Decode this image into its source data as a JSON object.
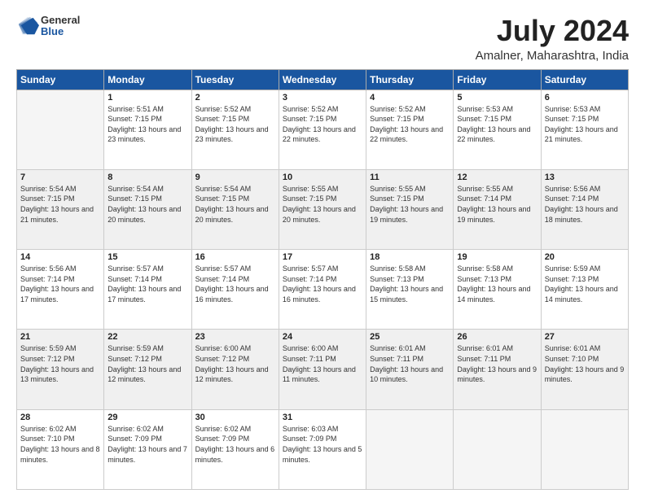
{
  "logo": {
    "general": "General",
    "blue": "Blue"
  },
  "title": "July 2024",
  "location": "Amalner, Maharashtra, India",
  "days_of_week": [
    "Sunday",
    "Monday",
    "Tuesday",
    "Wednesday",
    "Thursday",
    "Friday",
    "Saturday"
  ],
  "weeks": [
    [
      {
        "day": "",
        "sunrise": "",
        "sunset": "",
        "daylight": ""
      },
      {
        "day": "1",
        "sunrise": "Sunrise: 5:51 AM",
        "sunset": "Sunset: 7:15 PM",
        "daylight": "Daylight: 13 hours and 23 minutes."
      },
      {
        "day": "2",
        "sunrise": "Sunrise: 5:52 AM",
        "sunset": "Sunset: 7:15 PM",
        "daylight": "Daylight: 13 hours and 23 minutes."
      },
      {
        "day": "3",
        "sunrise": "Sunrise: 5:52 AM",
        "sunset": "Sunset: 7:15 PM",
        "daylight": "Daylight: 13 hours and 22 minutes."
      },
      {
        "day": "4",
        "sunrise": "Sunrise: 5:52 AM",
        "sunset": "Sunset: 7:15 PM",
        "daylight": "Daylight: 13 hours and 22 minutes."
      },
      {
        "day": "5",
        "sunrise": "Sunrise: 5:53 AM",
        "sunset": "Sunset: 7:15 PM",
        "daylight": "Daylight: 13 hours and 22 minutes."
      },
      {
        "day": "6",
        "sunrise": "Sunrise: 5:53 AM",
        "sunset": "Sunset: 7:15 PM",
        "daylight": "Daylight: 13 hours and 21 minutes."
      }
    ],
    [
      {
        "day": "7",
        "sunrise": "Sunrise: 5:54 AM",
        "sunset": "Sunset: 7:15 PM",
        "daylight": "Daylight: 13 hours and 21 minutes."
      },
      {
        "day": "8",
        "sunrise": "Sunrise: 5:54 AM",
        "sunset": "Sunset: 7:15 PM",
        "daylight": "Daylight: 13 hours and 20 minutes."
      },
      {
        "day": "9",
        "sunrise": "Sunrise: 5:54 AM",
        "sunset": "Sunset: 7:15 PM",
        "daylight": "Daylight: 13 hours and 20 minutes."
      },
      {
        "day": "10",
        "sunrise": "Sunrise: 5:55 AM",
        "sunset": "Sunset: 7:15 PM",
        "daylight": "Daylight: 13 hours and 20 minutes."
      },
      {
        "day": "11",
        "sunrise": "Sunrise: 5:55 AM",
        "sunset": "Sunset: 7:15 PM",
        "daylight": "Daylight: 13 hours and 19 minutes."
      },
      {
        "day": "12",
        "sunrise": "Sunrise: 5:55 AM",
        "sunset": "Sunset: 7:14 PM",
        "daylight": "Daylight: 13 hours and 19 minutes."
      },
      {
        "day": "13",
        "sunrise": "Sunrise: 5:56 AM",
        "sunset": "Sunset: 7:14 PM",
        "daylight": "Daylight: 13 hours and 18 minutes."
      }
    ],
    [
      {
        "day": "14",
        "sunrise": "Sunrise: 5:56 AM",
        "sunset": "Sunset: 7:14 PM",
        "daylight": "Daylight: 13 hours and 17 minutes."
      },
      {
        "day": "15",
        "sunrise": "Sunrise: 5:57 AM",
        "sunset": "Sunset: 7:14 PM",
        "daylight": "Daylight: 13 hours and 17 minutes."
      },
      {
        "day": "16",
        "sunrise": "Sunrise: 5:57 AM",
        "sunset": "Sunset: 7:14 PM",
        "daylight": "Daylight: 13 hours and 16 minutes."
      },
      {
        "day": "17",
        "sunrise": "Sunrise: 5:57 AM",
        "sunset": "Sunset: 7:14 PM",
        "daylight": "Daylight: 13 hours and 16 minutes."
      },
      {
        "day": "18",
        "sunrise": "Sunrise: 5:58 AM",
        "sunset": "Sunset: 7:13 PM",
        "daylight": "Daylight: 13 hours and 15 minutes."
      },
      {
        "day": "19",
        "sunrise": "Sunrise: 5:58 AM",
        "sunset": "Sunset: 7:13 PM",
        "daylight": "Daylight: 13 hours and 14 minutes."
      },
      {
        "day": "20",
        "sunrise": "Sunrise: 5:59 AM",
        "sunset": "Sunset: 7:13 PM",
        "daylight": "Daylight: 13 hours and 14 minutes."
      }
    ],
    [
      {
        "day": "21",
        "sunrise": "Sunrise: 5:59 AM",
        "sunset": "Sunset: 7:12 PM",
        "daylight": "Daylight: 13 hours and 13 minutes."
      },
      {
        "day": "22",
        "sunrise": "Sunrise: 5:59 AM",
        "sunset": "Sunset: 7:12 PM",
        "daylight": "Daylight: 13 hours and 12 minutes."
      },
      {
        "day": "23",
        "sunrise": "Sunrise: 6:00 AM",
        "sunset": "Sunset: 7:12 PM",
        "daylight": "Daylight: 13 hours and 12 minutes."
      },
      {
        "day": "24",
        "sunrise": "Sunrise: 6:00 AM",
        "sunset": "Sunset: 7:11 PM",
        "daylight": "Daylight: 13 hours and 11 minutes."
      },
      {
        "day": "25",
        "sunrise": "Sunrise: 6:01 AM",
        "sunset": "Sunset: 7:11 PM",
        "daylight": "Daylight: 13 hours and 10 minutes."
      },
      {
        "day": "26",
        "sunrise": "Sunrise: 6:01 AM",
        "sunset": "Sunset: 7:11 PM",
        "daylight": "Daylight: 13 hours and 9 minutes."
      },
      {
        "day": "27",
        "sunrise": "Sunrise: 6:01 AM",
        "sunset": "Sunset: 7:10 PM",
        "daylight": "Daylight: 13 hours and 9 minutes."
      }
    ],
    [
      {
        "day": "28",
        "sunrise": "Sunrise: 6:02 AM",
        "sunset": "Sunset: 7:10 PM",
        "daylight": "Daylight: 13 hours and 8 minutes."
      },
      {
        "day": "29",
        "sunrise": "Sunrise: 6:02 AM",
        "sunset": "Sunset: 7:09 PM",
        "daylight": "Daylight: 13 hours and 7 minutes."
      },
      {
        "day": "30",
        "sunrise": "Sunrise: 6:02 AM",
        "sunset": "Sunset: 7:09 PM",
        "daylight": "Daylight: 13 hours and 6 minutes."
      },
      {
        "day": "31",
        "sunrise": "Sunrise: 6:03 AM",
        "sunset": "Sunset: 7:09 PM",
        "daylight": "Daylight: 13 hours and 5 minutes."
      },
      {
        "day": "",
        "sunrise": "",
        "sunset": "",
        "daylight": ""
      },
      {
        "day": "",
        "sunrise": "",
        "sunset": "",
        "daylight": ""
      },
      {
        "day": "",
        "sunrise": "",
        "sunset": "",
        "daylight": ""
      }
    ]
  ]
}
